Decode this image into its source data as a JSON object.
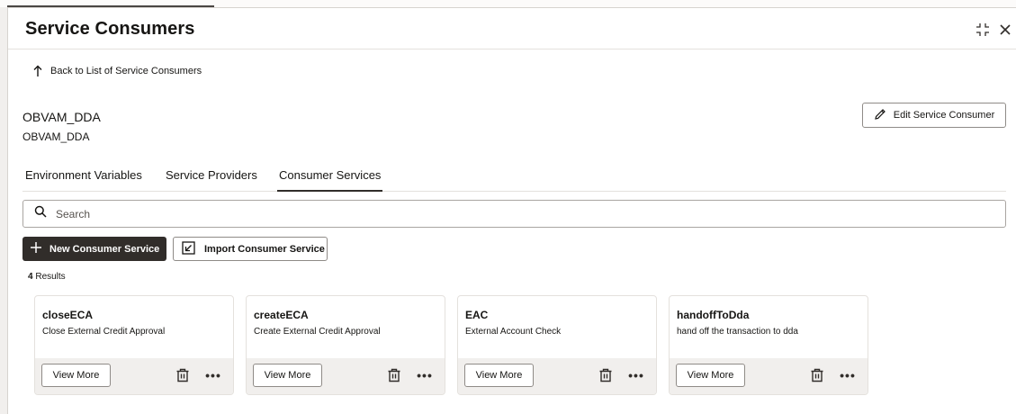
{
  "header": {
    "title": "Service Consumers"
  },
  "back_link": {
    "label": "Back to List of Service Consumers"
  },
  "consumer": {
    "name": "OBVAM_DDA",
    "subtitle": "OBVAM_DDA"
  },
  "edit_button": {
    "label": "Edit Service Consumer"
  },
  "tabs": [
    {
      "label": "Environment Variables",
      "active": false
    },
    {
      "label": "Service Providers",
      "active": false
    },
    {
      "label": "Consumer Services",
      "active": true
    }
  ],
  "search": {
    "placeholder": "Search",
    "value": ""
  },
  "toolbar": {
    "new_label": "New Consumer Service",
    "import_label": "Import Consumer Service"
  },
  "results": {
    "count": "4",
    "label": " Results"
  },
  "cards": [
    {
      "title": "closeECA",
      "description": "Close External Credit Approval",
      "view_label": "View More"
    },
    {
      "title": "createECA",
      "description": "Create External Credit Approval",
      "view_label": "View More"
    },
    {
      "title": "EAC",
      "description": "External Account Check",
      "view_label": "View More"
    },
    {
      "title": "handoffToDda",
      "description": "hand off the transaction to dda",
      "view_label": "View More"
    }
  ],
  "icons": {
    "collapse": "collapse-icon",
    "close": "close-icon",
    "back": "arrow-up-icon",
    "edit": "pencil-icon",
    "search": "search-icon",
    "add": "plus-icon",
    "import": "import-icon",
    "delete": "trash-icon",
    "more": "more-actions-icon"
  },
  "colors": {
    "primary_button": "#312d2a",
    "card_footer": "#f1efed",
    "border": "#8f8b87"
  }
}
